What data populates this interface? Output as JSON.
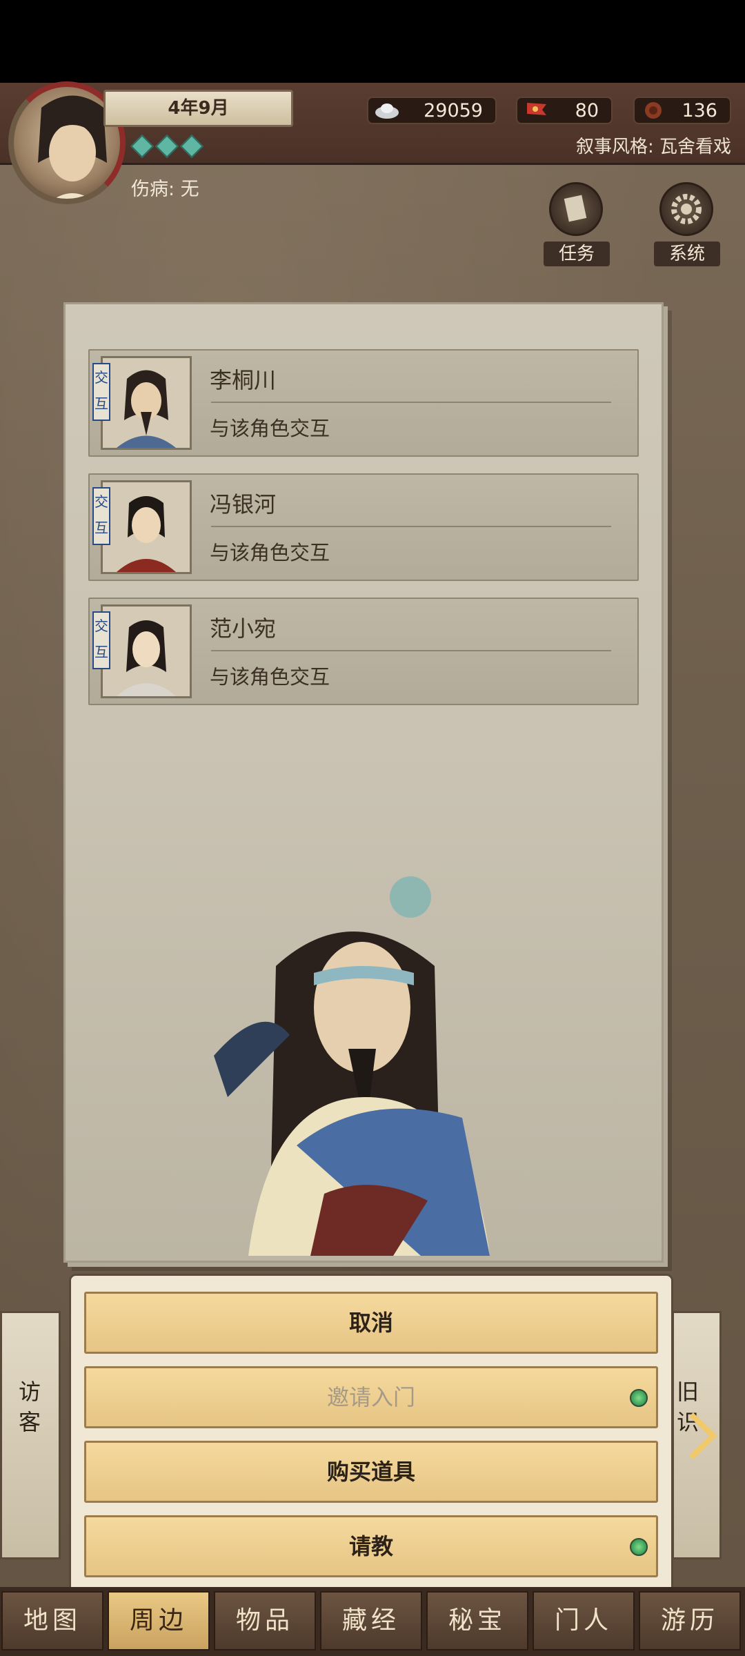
{
  "header": {
    "date": "4年9月",
    "injury_label": "伤病: 无",
    "narrative_style": "叙事风格: 瓦舍看戏",
    "resources": [
      {
        "name": "silver",
        "icon": "silver-ingot-icon",
        "value": "29059"
      },
      {
        "name": "prestige",
        "icon": "flag-icon",
        "value": "80"
      },
      {
        "name": "coins",
        "icon": "coin-icon",
        "value": "136"
      }
    ],
    "buttons": {
      "tasks": "任务",
      "system": "系统"
    }
  },
  "characters": [
    {
      "tag": "交互",
      "name": "李桐川",
      "action": "与该角色交互"
    },
    {
      "tag": "交互",
      "name": "冯银河",
      "action": "与该角色交互"
    },
    {
      "tag": "交互",
      "name": "范小宛",
      "action": "与该角色交互"
    }
  ],
  "dialog": {
    "cancel": "取消",
    "invite": "邀请入门",
    "buy_items": "购买道具",
    "consult": "请教"
  },
  "side": {
    "left": "访客",
    "right": "旧识"
  },
  "tabs": [
    "地图",
    "周边",
    "物品",
    "藏经",
    "秘宝",
    "门人",
    "游历"
  ],
  "active_tab": "周边",
  "colors": {
    "accent": "#8e2c2a",
    "button": "#f5d99d",
    "status_dot": "#3a9a55"
  }
}
